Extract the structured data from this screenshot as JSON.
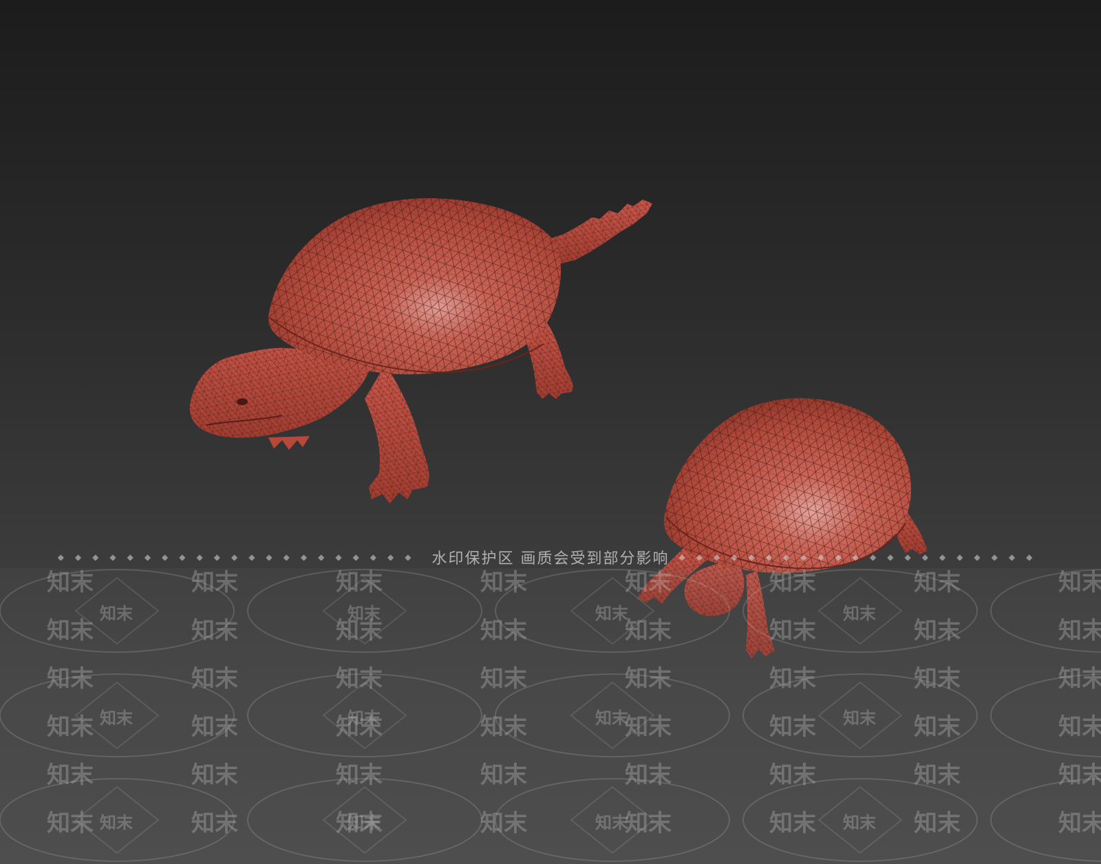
{
  "scene": {
    "background_top": "#1c1c1c",
    "background_bottom": "#4a4a4a",
    "model_color": "#c44c3e",
    "wire_color": "#3a1612"
  },
  "objects": [
    {
      "name": "snapping-turtle-model",
      "kind": "3d-wireframe"
    },
    {
      "name": "box-turtle-model",
      "kind": "3d-wireframe"
    }
  ],
  "watermark": {
    "notice": "水印保护区  画质会受到部分影响",
    "mark": "知末"
  }
}
